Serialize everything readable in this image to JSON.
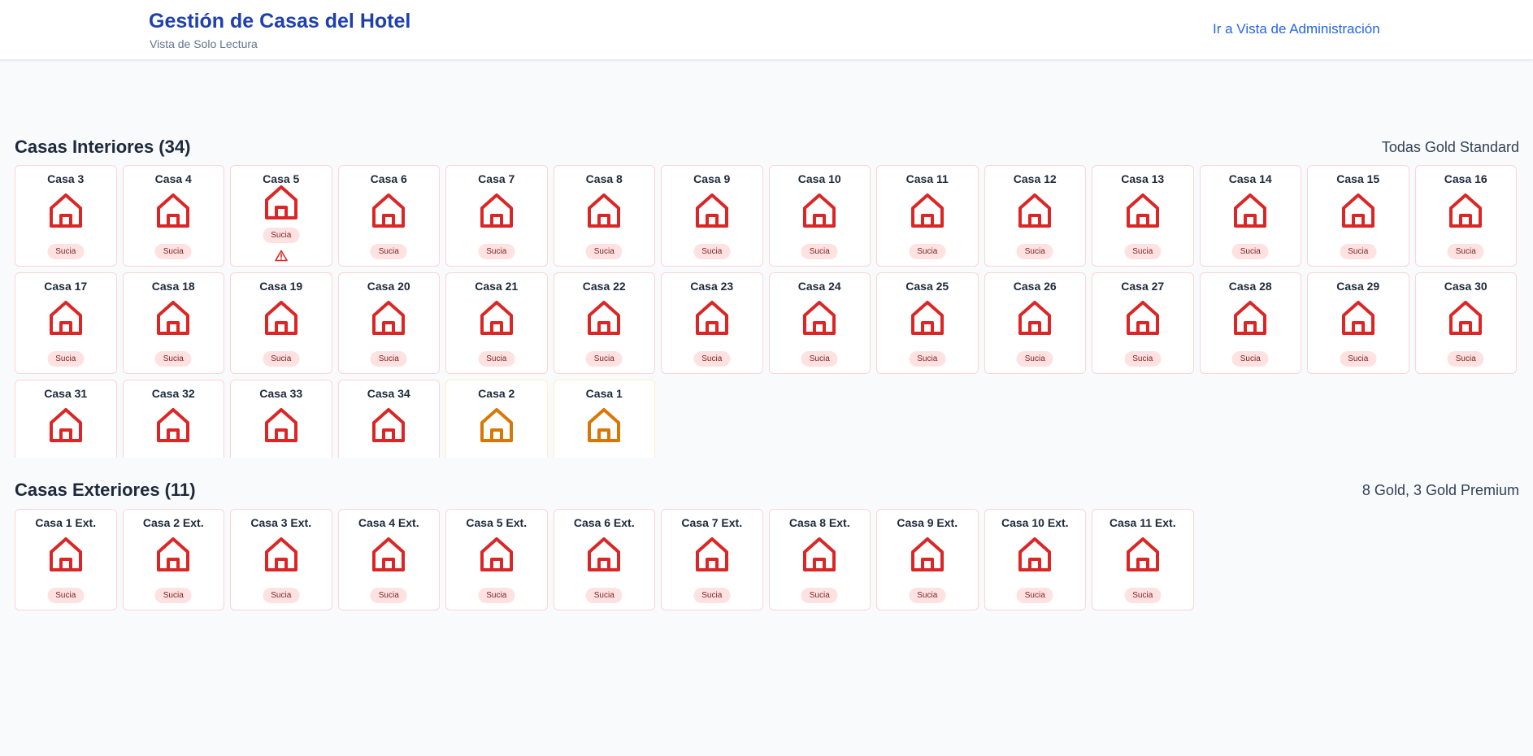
{
  "header": {
    "title": "Gestión de Casas del Hotel",
    "subtitle": "Vista de Solo Lectura",
    "admin_link": "Ir a Vista de Administración"
  },
  "colors": {
    "red": "#dc2626",
    "orange": "#d97706"
  },
  "interior": {
    "title": "Casas Interiores (34)",
    "summary": "Todas Gold Standard",
    "houses": [
      {
        "name": "Casa 3",
        "status": "Sucia",
        "color": "red"
      },
      {
        "name": "Casa 4",
        "status": "Sucia",
        "color": "red"
      },
      {
        "name": "Casa 5",
        "status": "Sucia",
        "color": "red",
        "alert": true
      },
      {
        "name": "Casa 6",
        "status": "Sucia",
        "color": "red"
      },
      {
        "name": "Casa 7",
        "status": "Sucia",
        "color": "red"
      },
      {
        "name": "Casa 8",
        "status": "Sucia",
        "color": "red"
      },
      {
        "name": "Casa 9",
        "status": "Sucia",
        "color": "red"
      },
      {
        "name": "Casa 10",
        "status": "Sucia",
        "color": "red"
      },
      {
        "name": "Casa 11",
        "status": "Sucia",
        "color": "red"
      },
      {
        "name": "Casa 12",
        "status": "Sucia",
        "color": "red"
      },
      {
        "name": "Casa 13",
        "status": "Sucia",
        "color": "red"
      },
      {
        "name": "Casa 14",
        "status": "Sucia",
        "color": "red"
      },
      {
        "name": "Casa 15",
        "status": "Sucia",
        "color": "red"
      },
      {
        "name": "Casa 16",
        "status": "Sucia",
        "color": "red"
      },
      {
        "name": "Casa 17",
        "status": "Sucia",
        "color": "red"
      },
      {
        "name": "Casa 18",
        "status": "Sucia",
        "color": "red"
      },
      {
        "name": "Casa 19",
        "status": "Sucia",
        "color": "red"
      },
      {
        "name": "Casa 20",
        "status": "Sucia",
        "color": "red"
      },
      {
        "name": "Casa 21",
        "status": "Sucia",
        "color": "red"
      },
      {
        "name": "Casa 22",
        "status": "Sucia",
        "color": "red"
      },
      {
        "name": "Casa 23",
        "status": "Sucia",
        "color": "red"
      },
      {
        "name": "Casa 24",
        "status": "Sucia",
        "color": "red"
      },
      {
        "name": "Casa 25",
        "status": "Sucia",
        "color": "red"
      },
      {
        "name": "Casa 26",
        "status": "Sucia",
        "color": "red"
      },
      {
        "name": "Casa 27",
        "status": "Sucia",
        "color": "red"
      },
      {
        "name": "Casa 28",
        "status": "Sucia",
        "color": "red"
      },
      {
        "name": "Casa 29",
        "status": "Sucia",
        "color": "red"
      },
      {
        "name": "Casa 30",
        "status": "Sucia",
        "color": "red"
      },
      {
        "name": "Casa 31",
        "color": "red"
      },
      {
        "name": "Casa 32",
        "color": "red"
      },
      {
        "name": "Casa 33",
        "color": "red"
      },
      {
        "name": "Casa 34",
        "color": "red"
      },
      {
        "name": "Casa 2",
        "color": "orange"
      },
      {
        "name": "Casa 1",
        "color": "orange"
      }
    ]
  },
  "exterior": {
    "title": "Casas Exteriores (11)",
    "summary": "8 Gold, 3 Gold Premium",
    "houses": [
      {
        "name": "Casa 1 Ext.",
        "status": "Sucia",
        "color": "red"
      },
      {
        "name": "Casa 2 Ext.",
        "status": "Sucia",
        "color": "red"
      },
      {
        "name": "Casa 3 Ext.",
        "status": "Sucia",
        "color": "red"
      },
      {
        "name": "Casa 4 Ext.",
        "status": "Sucia",
        "color": "red"
      },
      {
        "name": "Casa 5 Ext.",
        "status": "Sucia",
        "color": "red"
      },
      {
        "name": "Casa 6 Ext.",
        "status": "Sucia",
        "color": "red"
      },
      {
        "name": "Casa 7 Ext.",
        "status": "Sucia",
        "color": "red"
      },
      {
        "name": "Casa 8 Ext.",
        "status": "Sucia",
        "color": "red"
      },
      {
        "name": "Casa 9 Ext.",
        "status": "Sucia",
        "color": "red"
      },
      {
        "name": "Casa 10 Ext.",
        "status": "Sucia",
        "color": "red"
      },
      {
        "name": "Casa 11 Ext.",
        "status": "Sucia",
        "color": "red"
      }
    ]
  }
}
